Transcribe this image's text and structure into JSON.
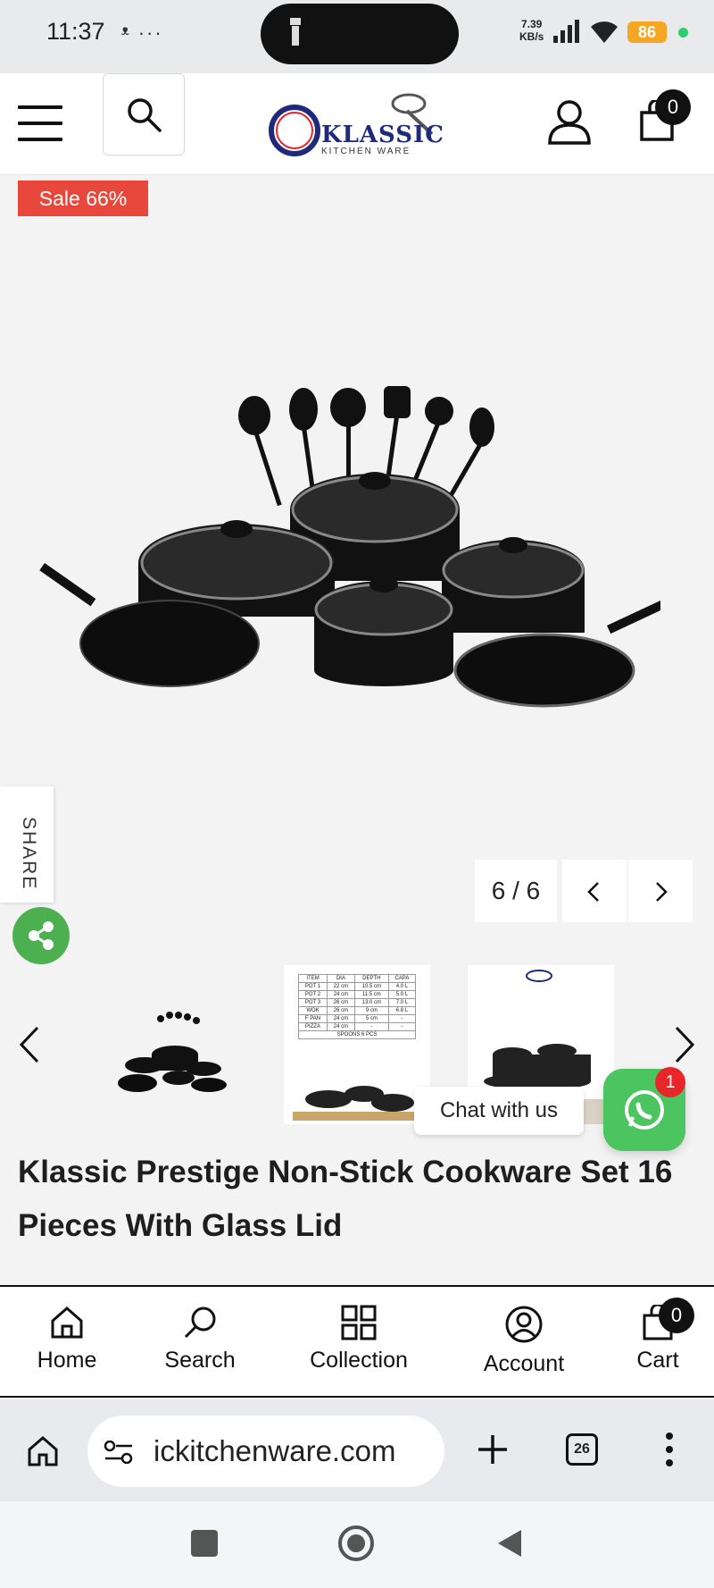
{
  "status_bar": {
    "time": "11:37",
    "left_icons": "ᵜ ···",
    "rate_value": "7.39",
    "rate_unit": "KB/s",
    "battery": "86"
  },
  "header": {
    "logo_text": "KLASSIC",
    "logo_sub": "KITCHEN WARE",
    "cart_count": "0"
  },
  "product": {
    "sale_badge": "Sale 66%",
    "image_counter": "6 / 6",
    "share_label": "SHARE",
    "title": "Klassic Prestige Non-Stick Cookware Set 16 Pieces With Glass Lid",
    "spec_table": {
      "headers": [
        "ITEM",
        "DIA",
        "DEPTH",
        "CAPA"
      ],
      "rows": [
        [
          "POT 1",
          "22 cm",
          "10.5 cm",
          "4.0 L"
        ],
        [
          "POT 2",
          "24 cm",
          "11.5 cm",
          "5.0 L"
        ],
        [
          "POT 3",
          "26 cm",
          "13.0 cm",
          "7.0 L"
        ],
        [
          "WOK",
          "26 cm",
          "9 cm",
          "6.8 L"
        ],
        [
          "F PAN",
          "24 cm",
          "5 cm",
          "-"
        ],
        [
          "PIZZA",
          "24 cm",
          "-",
          "-"
        ]
      ],
      "footer": "SPOONS 6 PCS"
    }
  },
  "chat": {
    "label": "Chat with us",
    "badge": "1"
  },
  "bottom_nav": {
    "items": [
      {
        "label": "Home",
        "icon": "home-icon"
      },
      {
        "label": "Search",
        "icon": "search-icon"
      },
      {
        "label": "Collection",
        "icon": "grid-icon"
      },
      {
        "label": "Account",
        "icon": "account-icon"
      },
      {
        "label": "Cart",
        "icon": "bag-icon"
      }
    ],
    "cart_count": "0"
  },
  "browser": {
    "url": "ickitchenware.com",
    "tab_count": "26"
  },
  "colors": {
    "sale": "#e8483b",
    "whatsapp": "#4cc460",
    "share": "#4caf50",
    "brand": "#1f2a7a"
  }
}
